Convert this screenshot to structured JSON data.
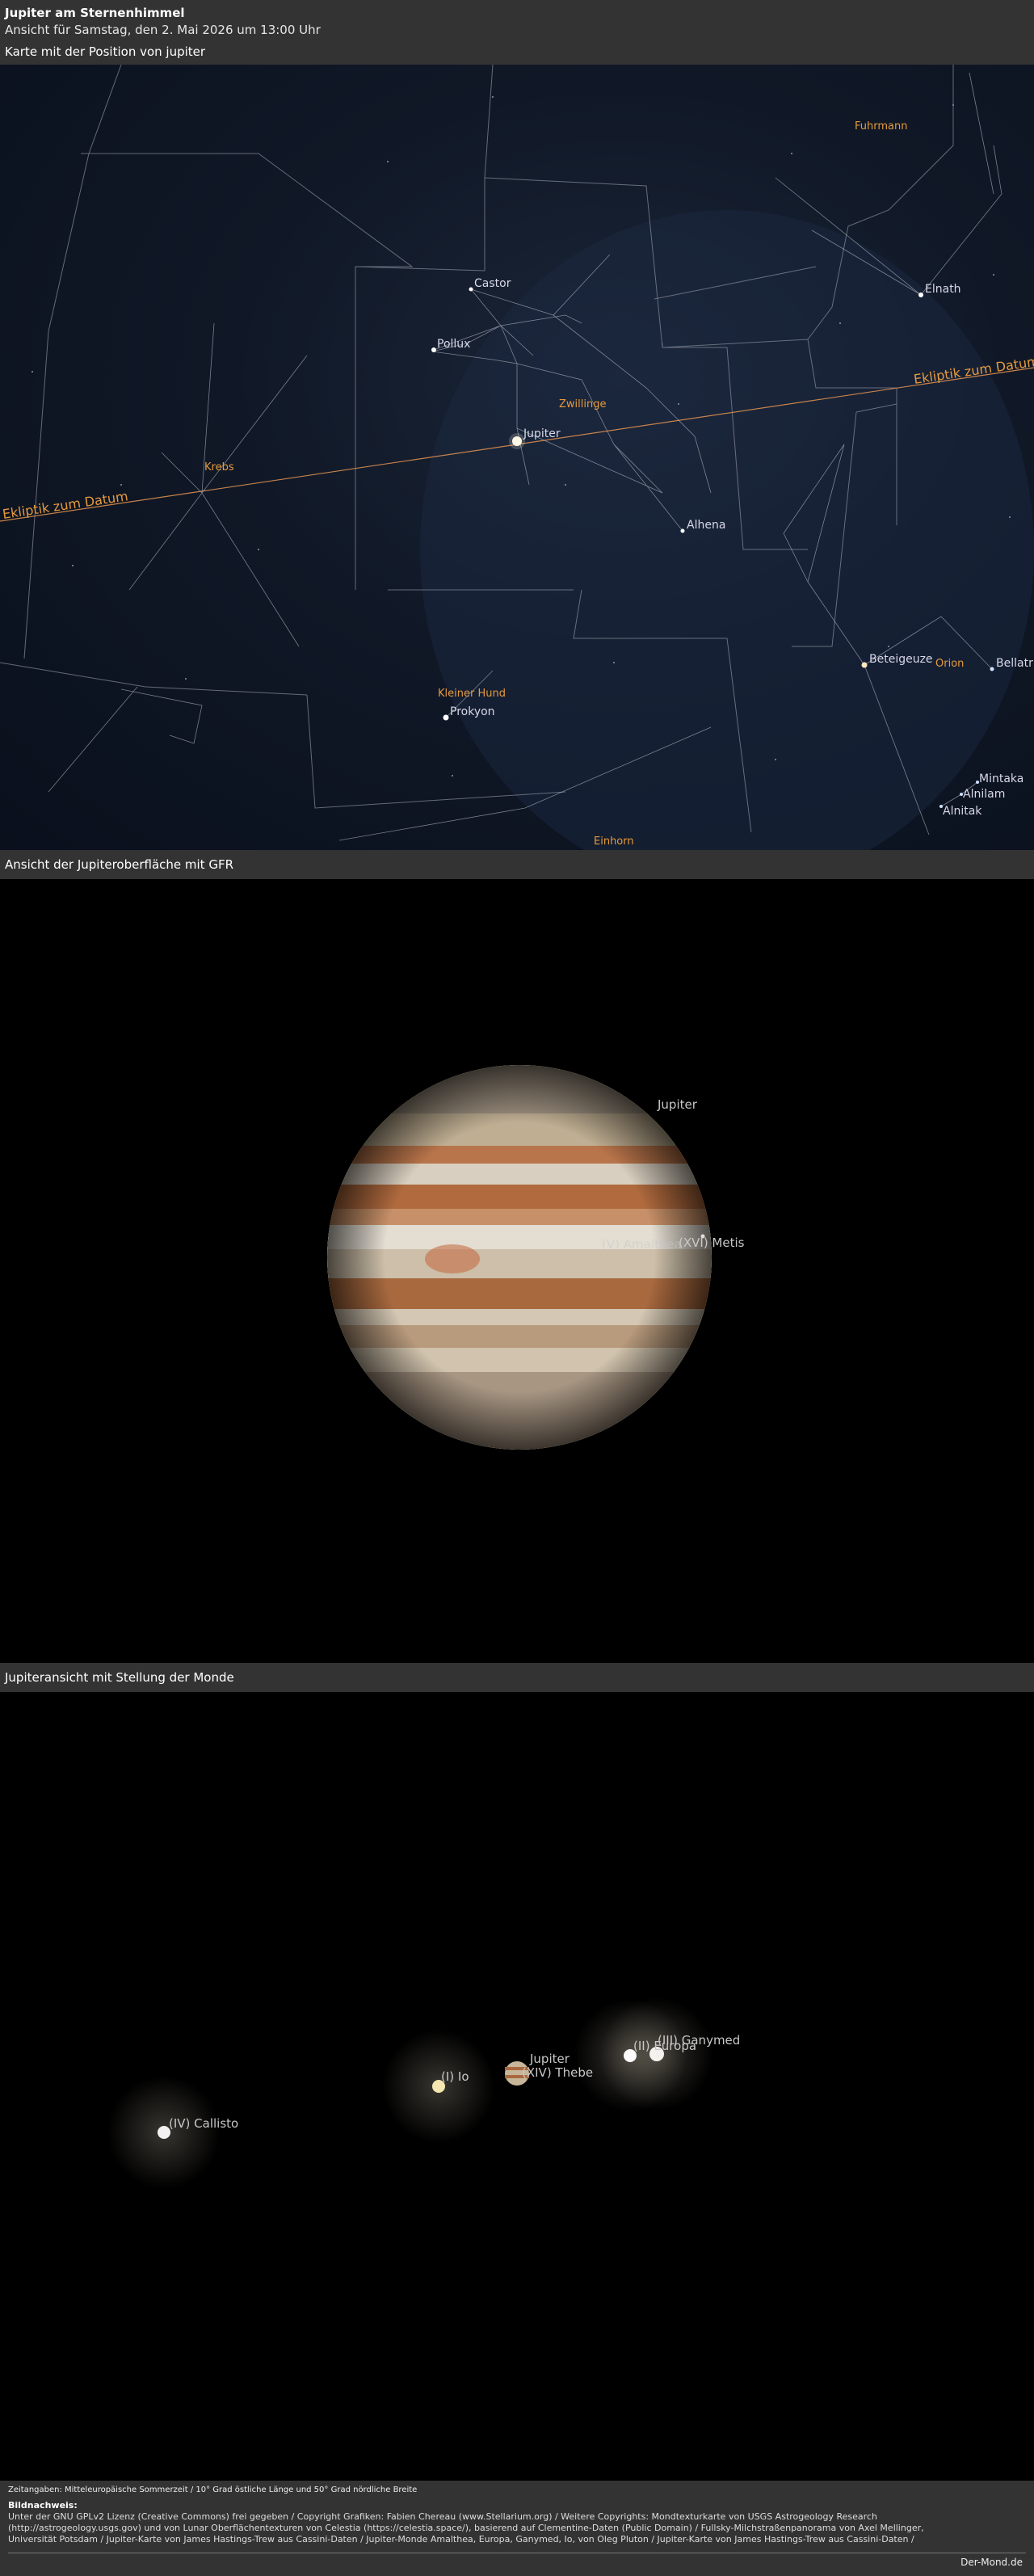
{
  "header": {
    "title": "Jupiter am Sternenhimmel",
    "subtitle": "Ansicht für Samstag, den 2. Mai 2026 um 13:00 Uhr",
    "map_label": "Karte mit der Position von jupiter"
  },
  "sky_map": {
    "stars": {
      "castor": "Castor",
      "pollux": "Pollux",
      "jupiter": "Jupiter",
      "alhena": "Alhena",
      "elnath": "Elnath",
      "beteigeuze": "Beteigeuze",
      "bellatrix": "Bellatrix",
      "prokyon": "Prokyon",
      "mintaka": "Mintaka",
      "alnilam": "Alnilam",
      "alnitak": "Alnitak"
    },
    "constellations": {
      "fuhrmann": "Fuhrmann",
      "zwillinge": "Zwillinge",
      "krebs": "Krebs",
      "kleiner_hund": "Kleiner Hund",
      "orion": "Orion",
      "einhorn": "Einhorn"
    },
    "ecliptic_left": "Ekliptik zum Datum",
    "ecliptic_right": "Ekliptik zum Datum"
  },
  "gfr_view": {
    "section_label": "Ansicht der Jupiteroberfläche mit GFR",
    "planet_label": "Jupiter",
    "moon_metis": "(XVI) Metis",
    "moon_amalthea": "(V) Amalthea"
  },
  "moons_view": {
    "section_label": "Jupiteransicht mit Stellung der Monde",
    "jupiter": "Jupiter",
    "thebe": "(XIV) Thebe",
    "io": "(I) Io",
    "europa": "(II) Europa",
    "ganymed": "(III) Ganymed",
    "callisto": "(IV) Callisto"
  },
  "footer": {
    "time_note": "Zeitangaben: Mitteleuropäische Sommerzeit / 10° Grad östliche Länge und 50° Grad nördliche Breite",
    "credits_heading": "Bildnachweis:",
    "credits_line1": "Unter der GNU GPLv2 Lizenz (Creative Commons) frei gegeben / Copyright Grafiken: Fabien Chereau (www.Stellarium.org) / Weitere Copyrights: Mondtexturkarte von USGS Astrogeology Research",
    "credits_line2": "(http://astrogeology.usgs.gov) und von Lunar Oberflächentexturen von Celestia (https://celestia.space/), basierend auf Clementine-Daten (Public Domain) / Fullsky-Milchstraßenpanorama von Axel Mellinger,",
    "credits_line3": "Universität Potsdam / Jupiter-Karte von James Hastings-Trew aus Cassini-Daten / Jupiter-Monde Amalthea, Europa, Ganymed, Io, von Oleg Pluton / Jupiter-Karte von James Hastings-Trew aus Cassini-Daten /",
    "site": "Der-Mond.de"
  },
  "colors": {
    "header_bg": "#333333",
    "constellation_label": "#e69a3c",
    "star_label": "#d8d8e8"
  }
}
